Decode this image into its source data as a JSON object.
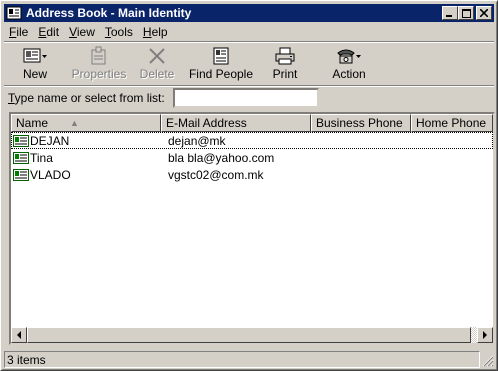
{
  "window": {
    "title": "Address Book - Main Identity",
    "controls": {
      "minimize": "minimize",
      "maximize": "maximize",
      "close": "close"
    }
  },
  "menu": [
    {
      "label": "File",
      "mnemonic": "F",
      "rest": "ile"
    },
    {
      "label": "Edit",
      "mnemonic": "E",
      "rest": "dit"
    },
    {
      "label": "View",
      "mnemonic": "V",
      "rest": "iew"
    },
    {
      "label": "Tools",
      "mnemonic": "T",
      "rest": "ools"
    },
    {
      "label": "Help",
      "mnemonic": "H",
      "rest": "elp"
    }
  ],
  "toolbar": {
    "new_label": "New",
    "properties_label": "Properties",
    "delete_label": "Delete",
    "find_people_label": "Find People",
    "print_label": "Print",
    "action_label": "Action"
  },
  "search": {
    "label_mnemonic": "T",
    "label_rest": "ype name or select from list:",
    "value": ""
  },
  "list": {
    "columns": [
      "Name",
      "E-Mail Address",
      "Business Phone",
      "Home Phone"
    ],
    "sort_indicator": "▲",
    "rows": [
      {
        "name": "DEJAN",
        "email": "dejan@mk",
        "business_phone": "",
        "home_phone": ""
      },
      {
        "name": "Tina",
        "email": "bla bla@yahoo.com",
        "business_phone": "",
        "home_phone": ""
      },
      {
        "name": "VLADO",
        "email": "vgstc02@com.mk",
        "business_phone": "",
        "home_phone": ""
      }
    ]
  },
  "status": {
    "text": "3 items"
  },
  "colors": {
    "titlebar": "#0a246a",
    "face": "#d4d0c8"
  }
}
